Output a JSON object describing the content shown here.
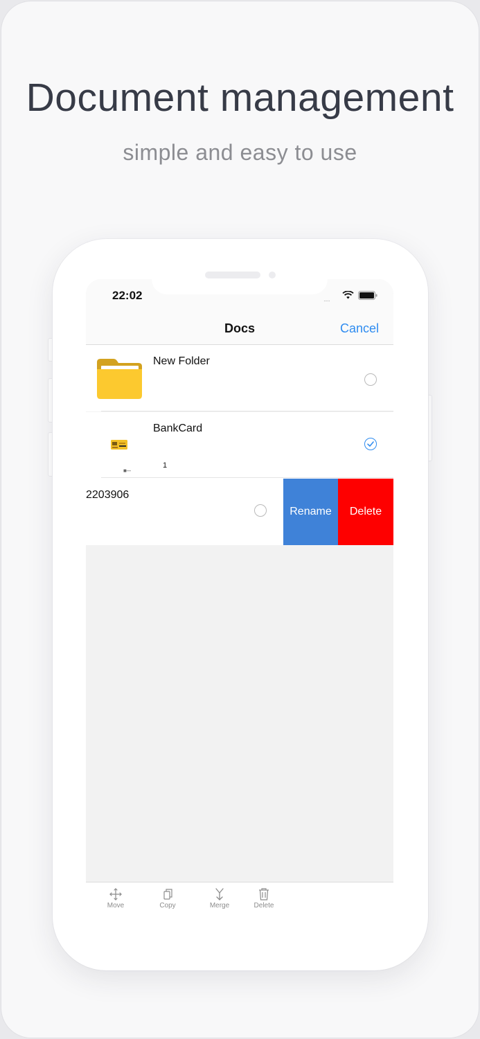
{
  "promo": {
    "headline": "Document management",
    "subline": "simple and easy to use"
  },
  "status_bar": {
    "time": "22:02",
    "signal": "....."
  },
  "nav": {
    "title": "Docs",
    "cancel_label": "Cancel"
  },
  "documents": [
    {
      "name": "New Folder",
      "type": "folder",
      "selected": false
    },
    {
      "name": "BankCard",
      "type": "document",
      "page_count": "1",
      "thumb_caption": "■---",
      "selected": true
    },
    {
      "name": "2203906",
      "type": "document",
      "selected": false,
      "swiped": true
    }
  ],
  "swipe_actions": {
    "rename_label": "Rename",
    "delete_label": "Delete"
  },
  "toolbar": {
    "items": [
      {
        "label": "Move",
        "icon": "move-icon"
      },
      {
        "label": "Copy",
        "icon": "copy-icon"
      },
      {
        "label": "Merge",
        "icon": "merge-icon"
      },
      {
        "label": "Delete",
        "icon": "trash-icon"
      }
    ]
  },
  "colors": {
    "accent": "#2f8cf0",
    "rename": "#3f82d8",
    "delete": "#fe0000",
    "folder": "#fcc92f"
  }
}
